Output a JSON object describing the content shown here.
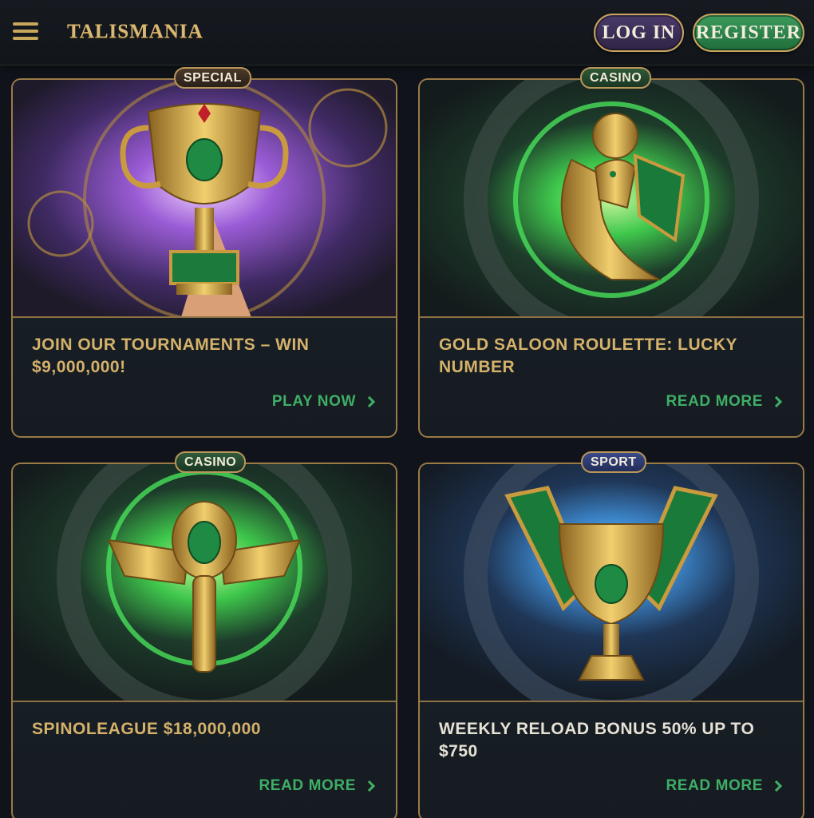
{
  "header": {
    "logo": "TALISMANIA",
    "login_label": "LOG IN",
    "register_label": "REGISTER"
  },
  "promotions": [
    {
      "badge": "SPECIAL",
      "title": "JOIN OUR TOURNAMENTS – WIN $9,000,000!",
      "link": "PLAY NOW"
    },
    {
      "badge": "CASINO",
      "title": "GOLD SALOON ROULETTE: LUCKY NUMBER",
      "link": "READ MORE"
    },
    {
      "badge": "CASINO",
      "title": "SPINOLEAGUE $18,000,000",
      "link": "READ MORE"
    },
    {
      "badge": "SPORT",
      "title": "WEEKLY RELOAD BONUS 50% UP TO $750",
      "link": "READ MORE"
    }
  ],
  "colors": {
    "gold": "#d5b26b",
    "green_link": "#3fae66",
    "special_bg": "#3a2c20",
    "casino_bg": "#244a2f",
    "sport_bg": "#2e3a72"
  },
  "icons": [
    "menu-icon",
    "chevron-right-icon",
    "trophy-cup-icon",
    "horus-falcon-icon",
    "winged-amulet-icon",
    "winged-cup-icon"
  ]
}
